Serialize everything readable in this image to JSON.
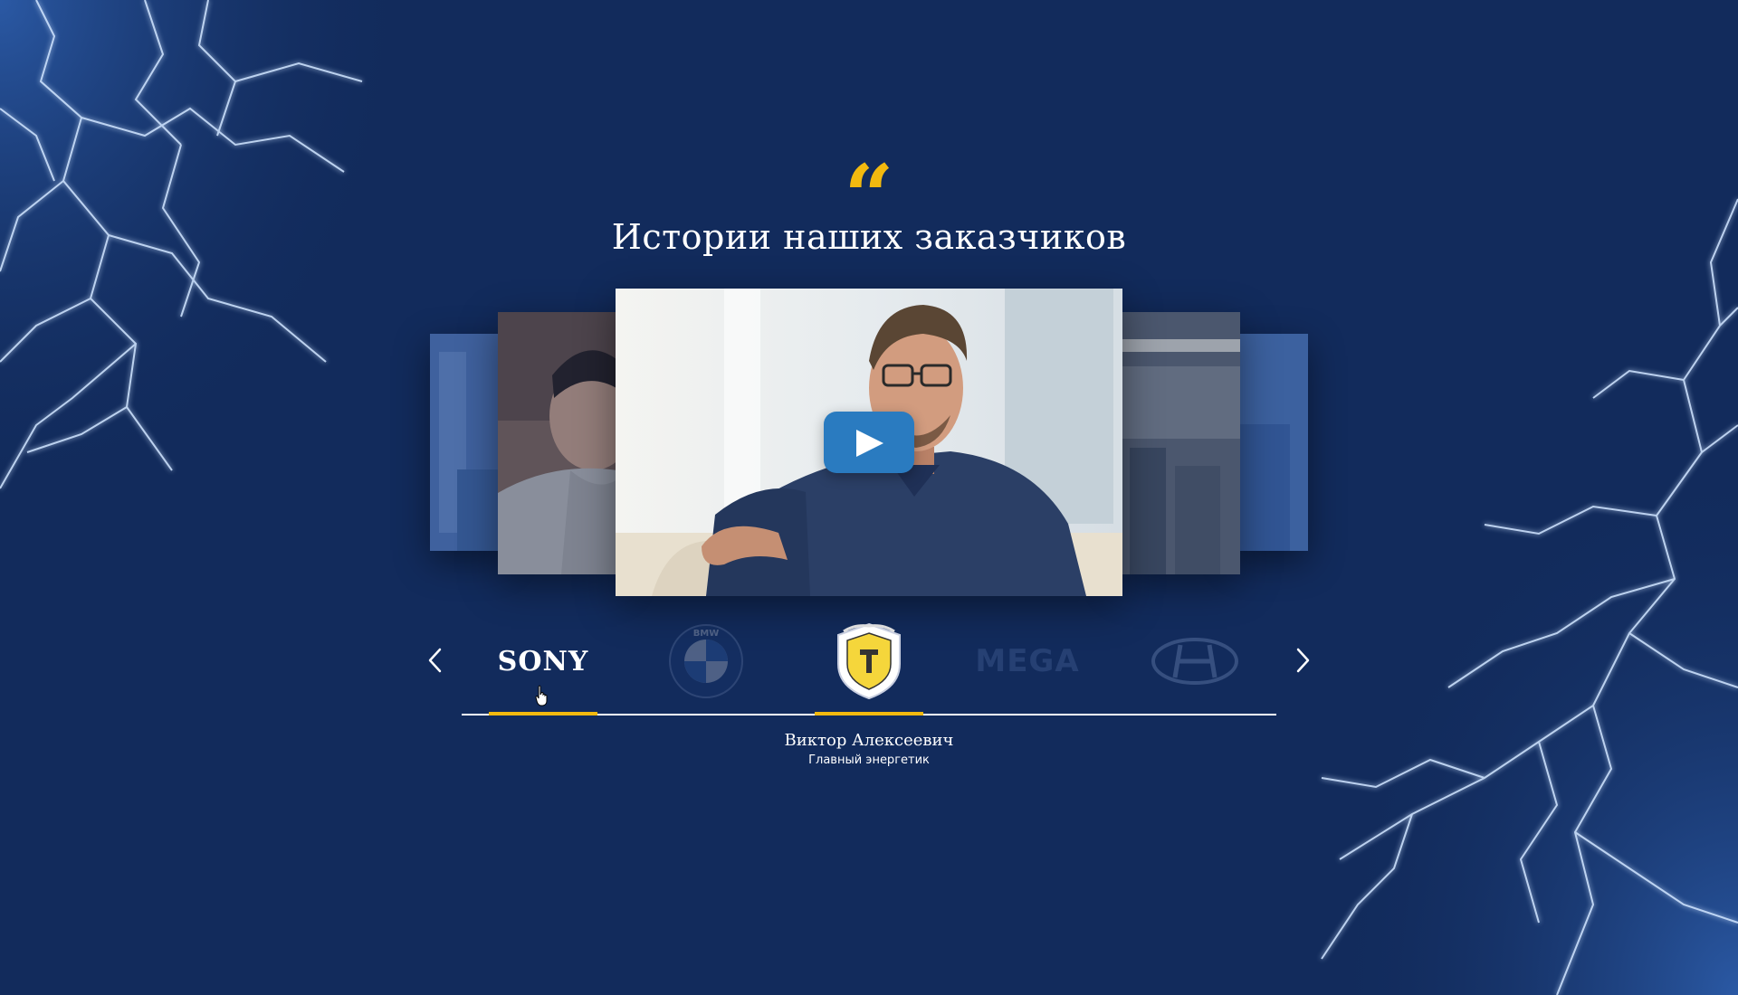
{
  "header": {
    "quote_glyph": "“",
    "title": "Истории наших заказчиков"
  },
  "colors": {
    "background": "#122b5c",
    "accent": "#f2b90f",
    "play_button": "#2a7bc0"
  },
  "carousel": {
    "play_icon": "play-icon",
    "prev_icon": "chevron-left-icon",
    "next_icon": "chevron-right-icon"
  },
  "logos": {
    "sony": "SONY",
    "bmw": "BMW",
    "tinkoff": "tinkoff-bank-logo",
    "mega": "MEGA",
    "hyundai": "hyundai-logo"
  },
  "testimonial": {
    "name": "Виктор Алексеевич",
    "role": "Главный энергетик"
  }
}
